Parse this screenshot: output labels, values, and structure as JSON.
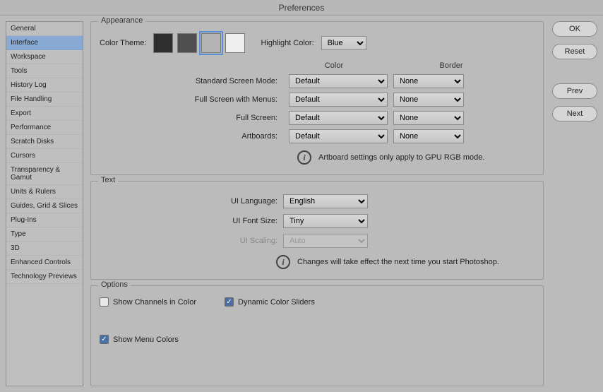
{
  "title": "Preferences",
  "sidebar": {
    "items": [
      {
        "label": "General",
        "selected": false
      },
      {
        "label": "Interface",
        "selected": true
      },
      {
        "label": "Workspace",
        "selected": false
      },
      {
        "label": "Tools",
        "selected": false
      },
      {
        "label": "History Log",
        "selected": false
      },
      {
        "label": "File Handling",
        "selected": false
      },
      {
        "label": "Export",
        "selected": false
      },
      {
        "label": "Performance",
        "selected": false
      },
      {
        "label": "Scratch Disks",
        "selected": false
      },
      {
        "label": "Cursors",
        "selected": false
      },
      {
        "label": "Transparency & Gamut",
        "selected": false
      },
      {
        "label": "Units & Rulers",
        "selected": false
      },
      {
        "label": "Guides, Grid & Slices",
        "selected": false
      },
      {
        "label": "Plug-Ins",
        "selected": false
      },
      {
        "label": "Type",
        "selected": false
      },
      {
        "label": "3D",
        "selected": false
      },
      {
        "label": "Enhanced Controls",
        "selected": false
      },
      {
        "label": "Technology Previews",
        "selected": false
      }
    ]
  },
  "appearance": {
    "legend": "Appearance",
    "color_theme_label": "Color Theme:",
    "swatches": [
      {
        "color": "#2e2e2e",
        "selected": false
      },
      {
        "color": "#4f4f4f",
        "selected": false
      },
      {
        "color": "#b4b4b4",
        "selected": true
      },
      {
        "color": "#efefef",
        "selected": false
      }
    ],
    "highlight_label": "Highlight Color:",
    "highlight_value": "Blue",
    "headers": {
      "color": "Color",
      "border": "Border"
    },
    "modes": [
      {
        "label": "Standard Screen Mode:",
        "color": "Default",
        "border": "None"
      },
      {
        "label": "Full Screen with Menus:",
        "color": "Default",
        "border": "None"
      },
      {
        "label": "Full Screen:",
        "color": "Default",
        "border": "None"
      },
      {
        "label": "Artboards:",
        "color": "Default",
        "border": "None"
      }
    ],
    "info": "Artboard settings only apply to GPU RGB mode."
  },
  "text": {
    "legend": "Text",
    "rows": {
      "language": {
        "label": "UI Language:",
        "value": "English"
      },
      "font_size": {
        "label": "UI Font Size:",
        "value": "Tiny"
      },
      "scaling": {
        "label": "UI Scaling:",
        "value": "Auto"
      }
    },
    "info": "Changes will take effect the next time you start Photoshop."
  },
  "options": {
    "legend": "Options",
    "items": [
      {
        "label": "Show Channels in Color",
        "checked": false
      },
      {
        "label": "Dynamic Color Sliders",
        "checked": true
      },
      {
        "label": "Show Menu Colors",
        "checked": true
      }
    ]
  },
  "buttons": {
    "ok": "OK",
    "reset": "Reset",
    "prev": "Prev",
    "next": "Next"
  }
}
